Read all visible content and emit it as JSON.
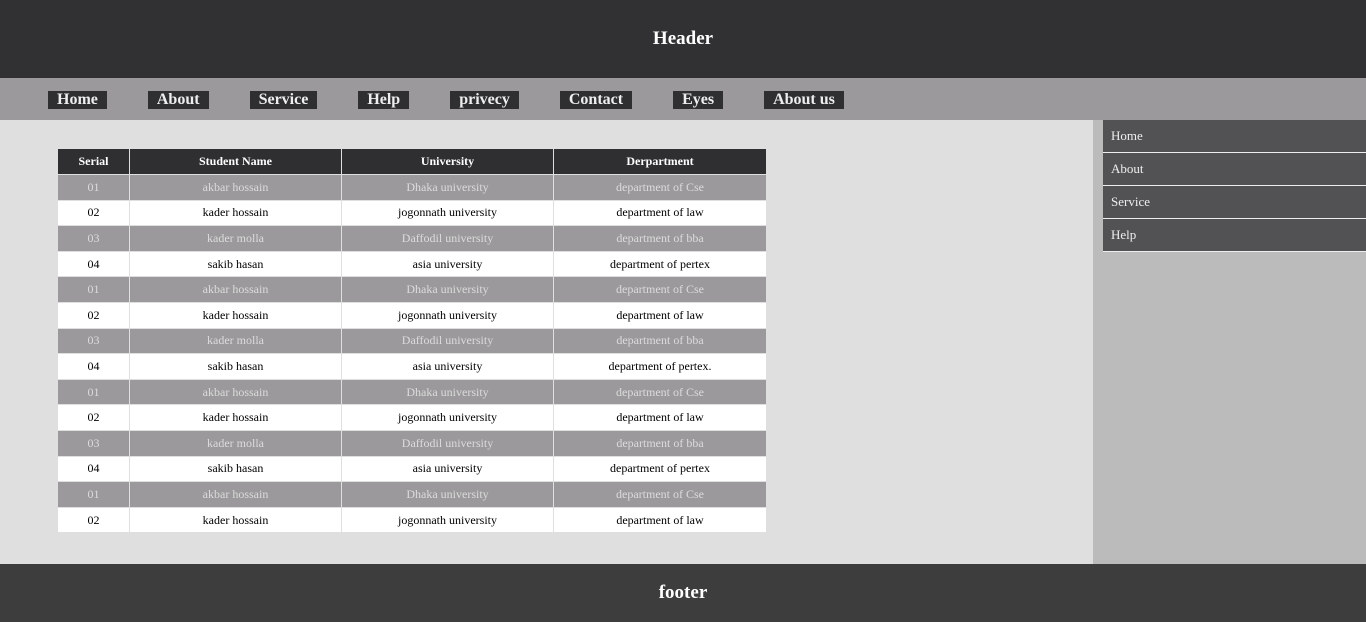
{
  "header": {
    "title": "Header"
  },
  "nav": [
    "Home",
    "About",
    "Service",
    "Help",
    "privecy",
    "Contact",
    "Eyes",
    "About us"
  ],
  "table": {
    "columns": [
      "Serial",
      "Student Name",
      "University",
      "Derpartment"
    ],
    "rows": [
      [
        "01",
        "akbar hossain",
        "Dhaka university",
        "department of Cse"
      ],
      [
        "02",
        "kader hossain",
        "jogonnath university",
        "department of law"
      ],
      [
        "03",
        "kader molla",
        "Daffodil university",
        "department of bba"
      ],
      [
        "04",
        "sakib hasan",
        "asia university",
        "department of pertex"
      ],
      [
        "01",
        "akbar hossain",
        "Dhaka university",
        "department of Cse"
      ],
      [
        "02",
        "kader hossain",
        "jogonnath university",
        "department of law"
      ],
      [
        "03",
        "kader molla",
        "Daffodil university",
        "department of bba"
      ],
      [
        "04",
        "sakib hasan",
        "asia university",
        "department of pertex."
      ],
      [
        "01",
        "akbar hossain",
        "Dhaka university",
        "department of Cse"
      ],
      [
        "02",
        "kader hossain",
        "jogonnath university",
        "department of law"
      ],
      [
        "03",
        "kader molla",
        "Daffodil university",
        "department of bba"
      ],
      [
        "04",
        "sakib hasan",
        "asia university",
        "department of pertex"
      ],
      [
        "01",
        "akbar hossain",
        "Dhaka university",
        "department of Cse"
      ],
      [
        "02",
        "kader hossain",
        "jogonnath university",
        "department of law"
      ]
    ]
  },
  "sidebar": [
    "Home",
    "About",
    "Service",
    "Help"
  ],
  "footer": {
    "text": "footer"
  }
}
